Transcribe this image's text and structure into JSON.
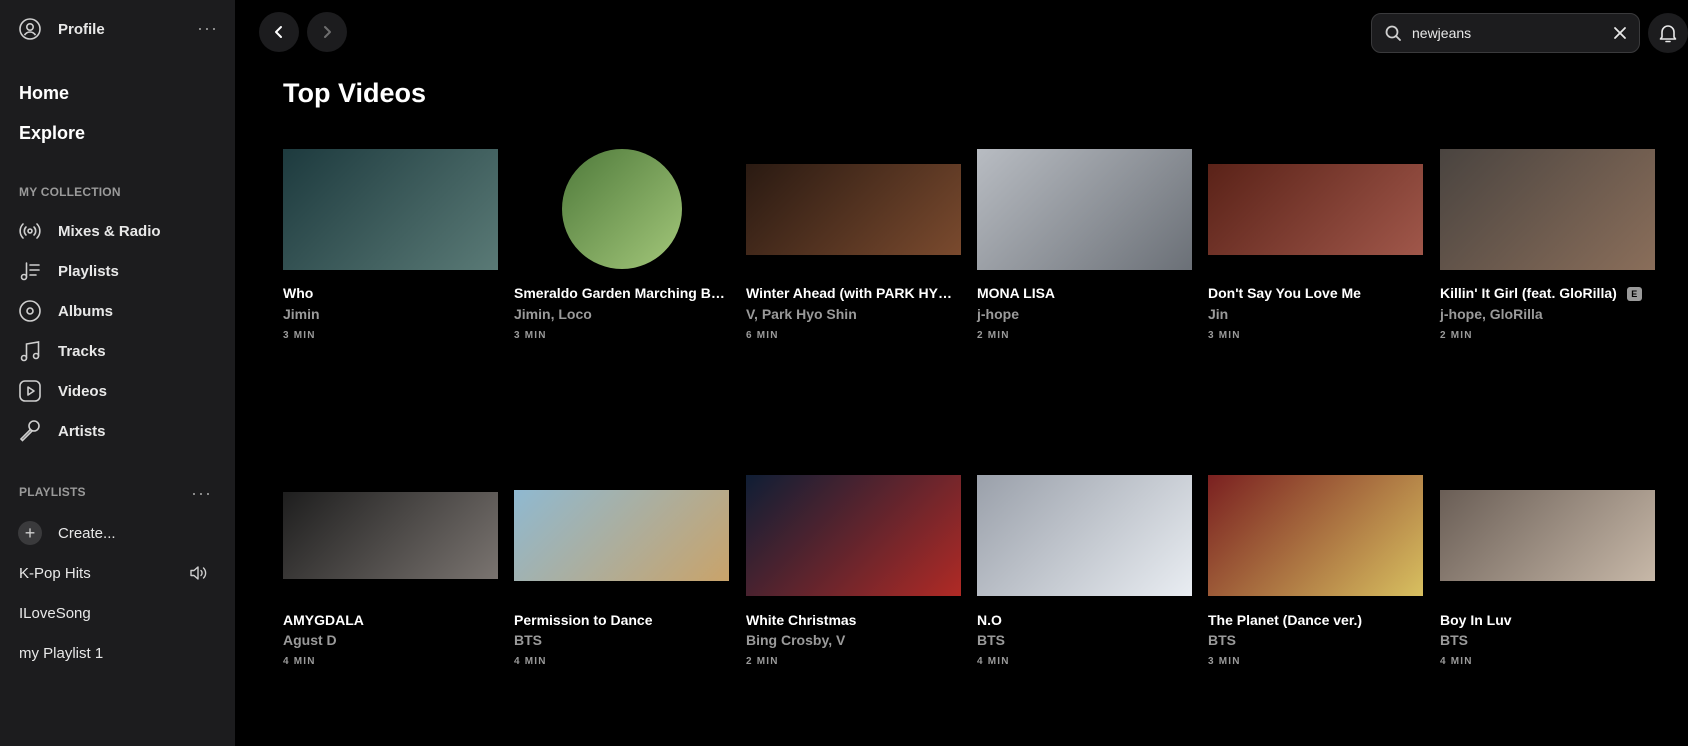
{
  "profile": {
    "label": "Profile",
    "more": "···"
  },
  "nav": {
    "home": "Home",
    "explore": "Explore"
  },
  "collection": {
    "heading": "MY COLLECTION",
    "items": [
      {
        "label": "Mixes & Radio",
        "icon": "radio-icon"
      },
      {
        "label": "Playlists",
        "icon": "playlist-icon"
      },
      {
        "label": "Albums",
        "icon": "album-icon"
      },
      {
        "label": "Tracks",
        "icon": "music-note-icon"
      },
      {
        "label": "Videos",
        "icon": "video-play-icon"
      },
      {
        "label": "Artists",
        "icon": "microphone-icon"
      }
    ]
  },
  "playlists": {
    "heading": "PLAYLISTS",
    "more": "···",
    "create": "Create...",
    "items": [
      "K-Pop Hits",
      "ILoveSong",
      "my Playlist 1"
    ]
  },
  "search": {
    "value": "newjeans",
    "placeholder": "Search"
  },
  "page": {
    "title": "Top Videos"
  },
  "videos": [
    {
      "title": "Who",
      "artist": "Jimin",
      "duration": "3 MIN",
      "colors": [
        "#1d3a3e",
        "#5a7a76"
      ]
    },
    {
      "title": "Smeraldo Garden Marching Band",
      "artist": "Jimin, Loco",
      "duration": "3 MIN",
      "colors": [
        "#4f7a3b",
        "#a3c77a"
      ]
    },
    {
      "title": "Winter Ahead (with PARK HYO SHIN)",
      "artist": "V, Park Hyo Shin",
      "duration": "6 MIN",
      "colors": [
        "#2a1a12",
        "#7a4a2e"
      ]
    },
    {
      "title": "MONA LISA",
      "artist": "j-hope",
      "duration": "2 MIN",
      "colors": [
        "#b8bcc2",
        "#6b7077"
      ]
    },
    {
      "title": "Don't Say You Love Me",
      "artist": "Jin",
      "duration": "3 MIN",
      "colors": [
        "#5a2218",
        "#a0574a"
      ]
    },
    {
      "title": "Killin' It Girl (feat. GloRilla)",
      "artist": "j-hope, GloRilla",
      "duration": "2 MIN",
      "explicit": "E",
      "colors": [
        "#4a4440",
        "#8a6e5a"
      ]
    },
    {
      "title": "AMYGDALA",
      "artist": "Agust D",
      "duration": "4 MIN",
      "colors": [
        "#1e1e1e",
        "#7a7470"
      ]
    },
    {
      "title": "Permission to Dance",
      "artist": "BTS",
      "duration": "4 MIN",
      "colors": [
        "#8fb9d1",
        "#c9a36a"
      ]
    },
    {
      "title": "White Christmas",
      "artist": "Bing Crosby, V",
      "duration": "2 MIN",
      "colors": [
        "#0f1e35",
        "#b02a25"
      ]
    },
    {
      "title": "N.O",
      "artist": "BTS",
      "duration": "4 MIN",
      "colors": [
        "#9aa0aa",
        "#e9edf2"
      ]
    },
    {
      "title": "The Planet (Dance ver.)",
      "artist": "BTS",
      "duration": "3 MIN",
      "colors": [
        "#7a2020",
        "#d8c060"
      ]
    },
    {
      "title": "Boy In Luv",
      "artist": "BTS",
      "duration": "4 MIN",
      "colors": [
        "#6a5e56",
        "#c7b8a8"
      ]
    }
  ]
}
